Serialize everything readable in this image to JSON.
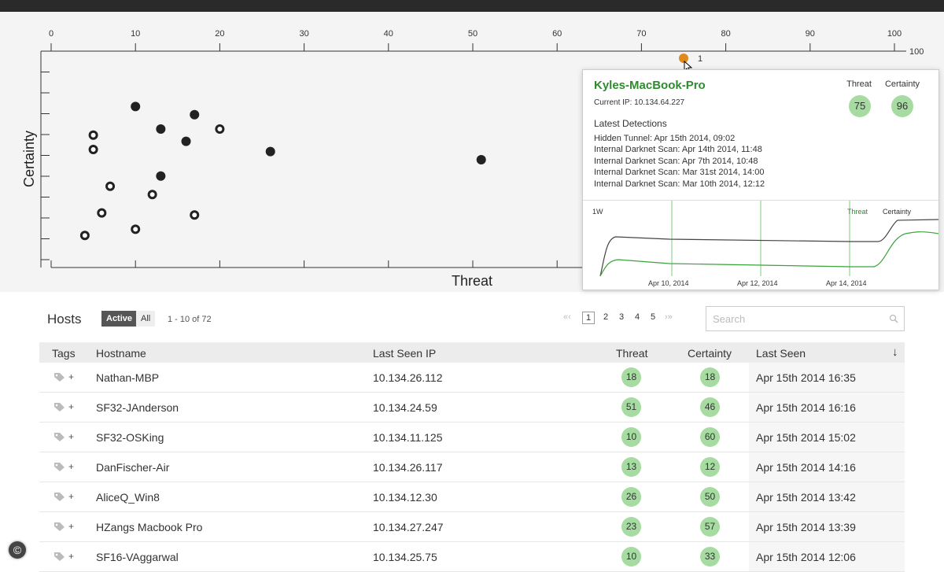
{
  "chart_data": {
    "type": "scatter",
    "xlabel": "Threat",
    "ylabel": "Certainty",
    "x_ticks": [
      0,
      10,
      20,
      30,
      40,
      50,
      60,
      70,
      80,
      90,
      100
    ],
    "x_tick_colors": [
      "#333",
      "#333",
      "#333",
      "#333",
      "#333",
      "#333",
      "#e8a23a",
      "#e8844a",
      "#e26a3a",
      "#d63a3a",
      "#d62020"
    ],
    "xlim": [
      0,
      100
    ],
    "right_tick_visible": "100",
    "points": [
      {
        "x": 10,
        "y": 76,
        "style": "filled"
      },
      {
        "x": 17,
        "y": 72,
        "style": "filled"
      },
      {
        "x": 13,
        "y": 65,
        "style": "filled"
      },
      {
        "x": 20,
        "y": 65,
        "style": "ring"
      },
      {
        "x": 5,
        "y": 62,
        "style": "ring"
      },
      {
        "x": 16,
        "y": 59,
        "style": "filled"
      },
      {
        "x": 5,
        "y": 55,
        "style": "ring"
      },
      {
        "x": 26,
        "y": 54,
        "style": "filled"
      },
      {
        "x": 51,
        "y": 50,
        "style": "filled"
      },
      {
        "x": 13,
        "y": 42,
        "style": "filled"
      },
      {
        "x": 7,
        "y": 37,
        "style": "ring"
      },
      {
        "x": 12,
        "y": 33,
        "style": "ring"
      },
      {
        "x": 6,
        "y": 24,
        "style": "ring"
      },
      {
        "x": 17,
        "y": 23,
        "style": "ring"
      },
      {
        "x": 10,
        "y": 16,
        "style": "ring"
      },
      {
        "x": 4,
        "y": 13,
        "style": "ring"
      },
      {
        "x": 75,
        "y": 96,
        "style": "highlight",
        "label": "1"
      }
    ]
  },
  "tooltip": {
    "hostname": "Kyles-MacBook-Pro",
    "current_ip": "Current IP: 10.134.64.227",
    "threat_label": "Threat",
    "threat_value": "75",
    "certainty_label": "Certainty",
    "certainty_value": "96",
    "latest_title": "Latest Detections",
    "detections": [
      "Hidden Tunnel: Apr 15th 2014, 09:02",
      "Internal Darknet Scan: Apr 14th 2014, 11:48",
      "Internal Darknet Scan: Apr 7th 2014, 10:48",
      "Internal Darknet Scan: Mar 31st 2014, 14:00",
      "Internal Darknet Scan: Mar 10th 2014, 12:12"
    ],
    "mini_chart": {
      "range_label": "1W",
      "threat_legend": "Threat",
      "certainty_legend": "Certainty",
      "dates": [
        "Apr 10, 2014",
        "Apr 12, 2014",
        "Apr 14, 2014"
      ]
    },
    "colors": {
      "host": "#2e8b2e",
      "threat_line": "#3aa33a",
      "certainty_line": "#444444",
      "badge": "#a6dba2"
    }
  },
  "hosts": {
    "title": "Hosts",
    "filter_active": "Active",
    "filter_all": "All",
    "count": "1 - 10 of 72",
    "pages": [
      "1",
      "2",
      "3",
      "4",
      "5"
    ],
    "prev_arrows": "«‹",
    "next_arrows": "›»",
    "search_placeholder": "Search",
    "columns": {
      "tags": "Tags",
      "hostname": "Hostname",
      "ip": "Last Seen IP",
      "threat": "Threat",
      "certainty": "Certainty",
      "last_seen": "Last Seen"
    },
    "rows": [
      {
        "hostname": "Nathan-MBP",
        "ip": "10.134.26.112",
        "threat": "18",
        "certainty": "18",
        "last_seen": "Apr 15th 2014 16:35"
      },
      {
        "hostname": "SF32-JAnderson",
        "ip": "10.134.24.59",
        "threat": "51",
        "certainty": "46",
        "last_seen": "Apr 15th 2014 16:16"
      },
      {
        "hostname": "SF32-OSKing",
        "ip": "10.134.11.125",
        "threat": "10",
        "certainty": "60",
        "last_seen": "Apr 15th 2014 15:02"
      },
      {
        "hostname": "DanFischer-Air",
        "ip": "10.134.26.117",
        "threat": "13",
        "certainty": "12",
        "last_seen": "Apr 15th 2014 14:16"
      },
      {
        "hostname": "AliceQ_Win8",
        "ip": "10.134.12.30",
        "threat": "26",
        "certainty": "50",
        "last_seen": "Apr 15th 2014 13:42"
      },
      {
        "hostname": "HZangs Macbook Pro",
        "ip": "10.134.27.247",
        "threat": "23",
        "certainty": "57",
        "last_seen": "Apr 15th 2014 13:39"
      },
      {
        "hostname": "SF16-VAggarwal",
        "ip": "10.134.25.75",
        "threat": "10",
        "certainty": "33",
        "last_seen": "Apr 15th 2014 12:06"
      }
    ],
    "tag_plus": "+"
  },
  "footer": {
    "copyright_symbol": "©"
  }
}
